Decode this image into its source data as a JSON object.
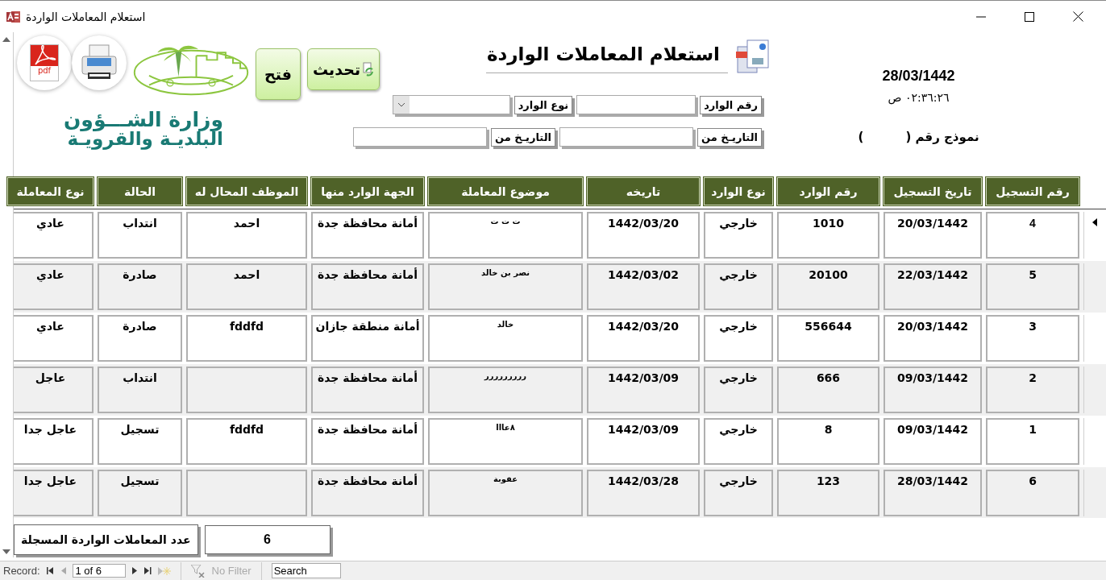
{
  "window": {
    "title": "استعلام المعاملات الواردة"
  },
  "header": {
    "logo": {
      "line_1": "وزارة الشـــؤون",
      "line_2": "البلديـة والقرويـة"
    },
    "pdf_label": "pdf",
    "buttons": [
      {
        "label": "تحديث",
        "kind": "refresh"
      },
      {
        "label": "فتح",
        "kind": "plain"
      }
    ],
    "title": "استعلام المعاملات الواردة",
    "date": "28/03/1442",
    "time": "٠٢:٣٦:٢٦ ص",
    "form_number": "نموذج رقم (          )"
  },
  "filters": [
    [
      {
        "label": "رقم الوارد",
        "kind": "text"
      },
      {
        "label": "نوع الوارد",
        "kind": "combo"
      }
    ],
    [
      {
        "label": "التاريـخ من",
        "kind": "text"
      },
      {
        "label": "التاريـخ من",
        "kind": "text"
      }
    ]
  ],
  "table": {
    "columns": [
      "رقم التسجيل",
      "تاريخ التسجيل",
      "رقم الوارد",
      "نوع الوارد",
      "تاريخه",
      "موضوع المعاملة",
      "الجهة الوارد منها",
      "الموظف المحال له",
      "الحالة",
      "نوع المعاملة"
    ],
    "rows": [
      {
        "selected": true,
        "cells": [
          "4",
          "20/03/1442",
          "1010",
          "خارجي",
          "1442/03/20",
          "ت ت ت",
          "أمانة محافظة جدة",
          "احمد",
          "انتداب",
          "عادي"
        ]
      },
      {
        "selected": false,
        "cells": [
          "5",
          "22/03/1442",
          "20100",
          "خارجي",
          "1442/03/02",
          "نصر بن خالد",
          "أمانة محافظة جدة",
          "احمد",
          "صادرة",
          "عادي"
        ]
      },
      {
        "selected": false,
        "cells": [
          "3",
          "20/03/1442",
          "556644",
          "خارجي",
          "1442/03/20",
          "خالد",
          "أمانة منطقة جازان",
          "fddfd",
          "صادرة",
          "عادي"
        ]
      },
      {
        "selected": false,
        "cells": [
          "2",
          "09/03/1442",
          "666",
          "خارجي",
          "1442/03/09",
          "ررررررررر",
          "أمانة محافظة جدة",
          null,
          "انتداب",
          "عاجل"
        ]
      },
      {
        "selected": false,
        "cells": [
          "1",
          "09/03/1442",
          "8",
          "خارجي",
          "1442/03/09",
          "٨عااا",
          "أمانة محافظة جدة",
          "fddfd",
          "تسجيل",
          "عاجل جدا"
        ]
      },
      {
        "selected": false,
        "cells": [
          "6",
          "28/03/1442",
          "123",
          "خارجي",
          "1442/03/28",
          "عقوبة",
          "أمانة محافظة جدة",
          null,
          "تسجيل",
          "عاجل جدا"
        ]
      }
    ]
  },
  "summary": {
    "label": "عدد المعاملات الواردة المسجلة",
    "value": "6"
  },
  "record_bar": {
    "label": "Record:",
    "position": "1 of 6",
    "filter": "No Filter",
    "search_placeholder": "Search"
  }
}
